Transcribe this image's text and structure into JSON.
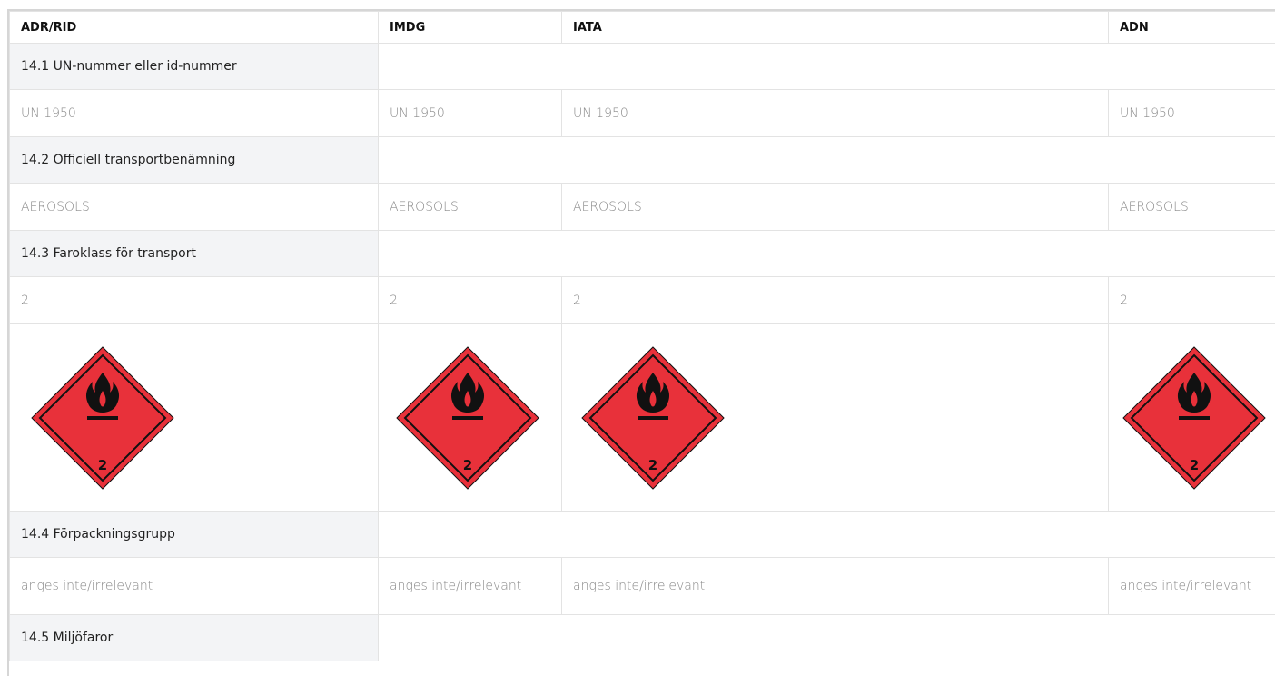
{
  "headers": [
    "ADR/RID",
    "IMDG",
    "IATA",
    "ADN"
  ],
  "sections": {
    "un_number": {
      "title": "14.1 UN-nummer eller id-nummer",
      "values": [
        "UN 1950",
        "UN 1950",
        "UN 1950",
        "UN 1950"
      ]
    },
    "shipping_name": {
      "title": "14.2 Officiell transportbenämning",
      "values": [
        "AEROSOLS",
        "AEROSOLS",
        "AEROSOLS",
        "AEROSOLS"
      ]
    },
    "hazard_class": {
      "title": "14.3 Faroklass för transport",
      "values": [
        "2",
        "2",
        "2",
        "2"
      ],
      "pictogram_number": "2",
      "pictogram_color": "#e8313a"
    },
    "packing_group": {
      "title": "14.4 Förpackningsgrupp",
      "values": [
        "anges inte/irrelevant",
        "anges inte/irrelevant",
        "anges inte/irrelevant",
        "anges inte/irrelevant"
      ]
    },
    "environmental": {
      "title": "14.5 Miljöfaror"
    }
  },
  "icons": [
    "flammable-gas-class-2-pictogram"
  ]
}
